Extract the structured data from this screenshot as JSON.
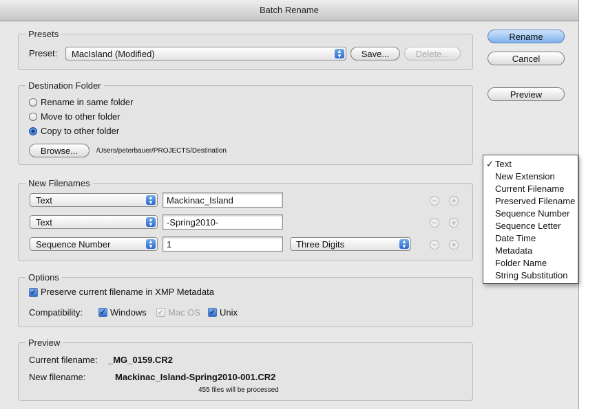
{
  "window": {
    "title": "Batch Rename"
  },
  "presets": {
    "legend": "Presets",
    "label": "Preset:",
    "value": "MacIsland (Modified)",
    "save_label": "Save...",
    "delete_label": "Delete..."
  },
  "actions": {
    "rename": "Rename",
    "cancel": "Cancel",
    "preview": "Preview"
  },
  "destination": {
    "legend": "Destination Folder",
    "options": [
      "Rename in same folder",
      "Move to other folder",
      "Copy to other folder"
    ],
    "selected_index": 2,
    "browse_label": "Browse...",
    "path": "/Users/peterbauer/PROJECTS/Destination"
  },
  "new_filenames": {
    "legend": "New Filenames",
    "rows": [
      {
        "type": "Text",
        "value": "Mackinac_Island"
      },
      {
        "type": "Text",
        "value": "-Spring2010-"
      },
      {
        "type": "Sequence Number",
        "value": "1",
        "digits": "Three Digits"
      }
    ]
  },
  "type_menu": {
    "items": [
      "Text",
      "New Extension",
      "Current Filename",
      "Preserved Filename",
      "Sequence Number",
      "Sequence Letter",
      "Date Time",
      "Metadata",
      "Folder Name",
      "String Substitution"
    ],
    "checked_index": 0
  },
  "options": {
    "legend": "Options",
    "preserve_label": "Preserve current filename in XMP Metadata",
    "preserve_checked": true,
    "compat_label": "Compatibility:",
    "windows": "Windows",
    "macos": "Mac OS",
    "unix": "Unix"
  },
  "preview": {
    "legend": "Preview",
    "current_label": "Current filename:",
    "current_value": "_MG_0159.CR2",
    "new_label": "New filename:",
    "new_value": "Mackinac_Island-Spring2010-001.CR2",
    "count_text": "455 files will be processed"
  }
}
